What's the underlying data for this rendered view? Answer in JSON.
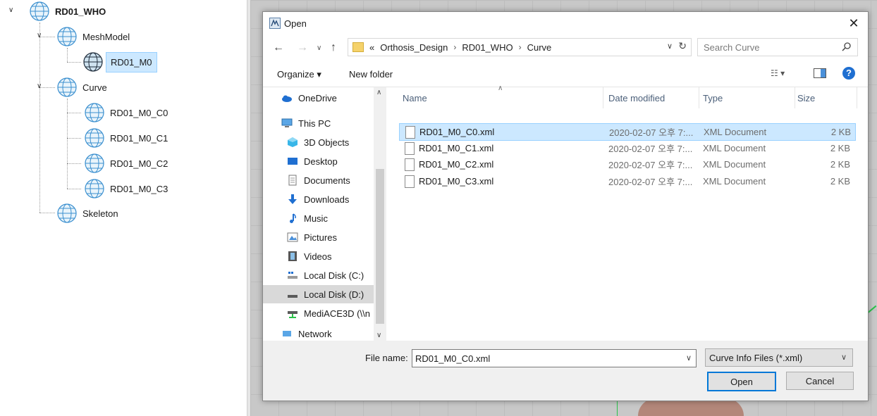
{
  "tree": {
    "root": "RD01_WHO",
    "nodes": {
      "meshmodel": "MeshModel",
      "mesh_m0": "RD01_M0",
      "curve": "Curve",
      "curve_c0": "RD01_M0_C0",
      "curve_c1": "RD01_M0_C1",
      "curve_c2": "RD01_M0_C2",
      "curve_c3": "RD01_M0_C3",
      "skeleton": "Skeleton"
    }
  },
  "dialog": {
    "title": "Open",
    "address": {
      "prefix": "«",
      "crumbs": [
        "Orthosis_Design",
        "RD01_WHO",
        "Curve"
      ]
    },
    "search_placeholder": "Search Curve",
    "toolbar": {
      "organize": "Organize ▾",
      "new_folder": "New folder"
    },
    "nav": [
      {
        "label": "OneDrive"
      },
      {
        "label": "This PC"
      },
      {
        "label": "3D Objects"
      },
      {
        "label": "Desktop"
      },
      {
        "label": "Documents"
      },
      {
        "label": "Downloads"
      },
      {
        "label": "Music"
      },
      {
        "label": "Pictures"
      },
      {
        "label": "Videos"
      },
      {
        "label": "Local Disk (C:)"
      },
      {
        "label": "Local Disk (D:)"
      },
      {
        "label": "MediACE3D (\\\\n"
      },
      {
        "label": "Network"
      }
    ],
    "columns": {
      "name": "Name",
      "date": "Date modified",
      "type": "Type",
      "size": "Size"
    },
    "files": [
      {
        "name": "RD01_M0_C0.xml",
        "date": "2020-02-07 오후 7:...",
        "type": "XML Document",
        "size": "2 KB"
      },
      {
        "name": "RD01_M0_C1.xml",
        "date": "2020-02-07 오후 7:...",
        "type": "XML Document",
        "size": "2 KB"
      },
      {
        "name": "RD01_M0_C2.xml",
        "date": "2020-02-07 오후 7:...",
        "type": "XML Document",
        "size": "2 KB"
      },
      {
        "name": "RD01_M0_C3.xml",
        "date": "2020-02-07 오후 7:...",
        "type": "XML Document",
        "size": "2 KB"
      }
    ],
    "file_name_label": "File name:",
    "file_name_value": "RD01_M0_C0.xml",
    "filter_value": "Curve Info Files (*.xml)",
    "open_button": "Open",
    "cancel_button": "Cancel"
  },
  "colors": {
    "selection": "#cce8ff",
    "selection_border": "#99d1ff",
    "accent": "#0078d7"
  }
}
